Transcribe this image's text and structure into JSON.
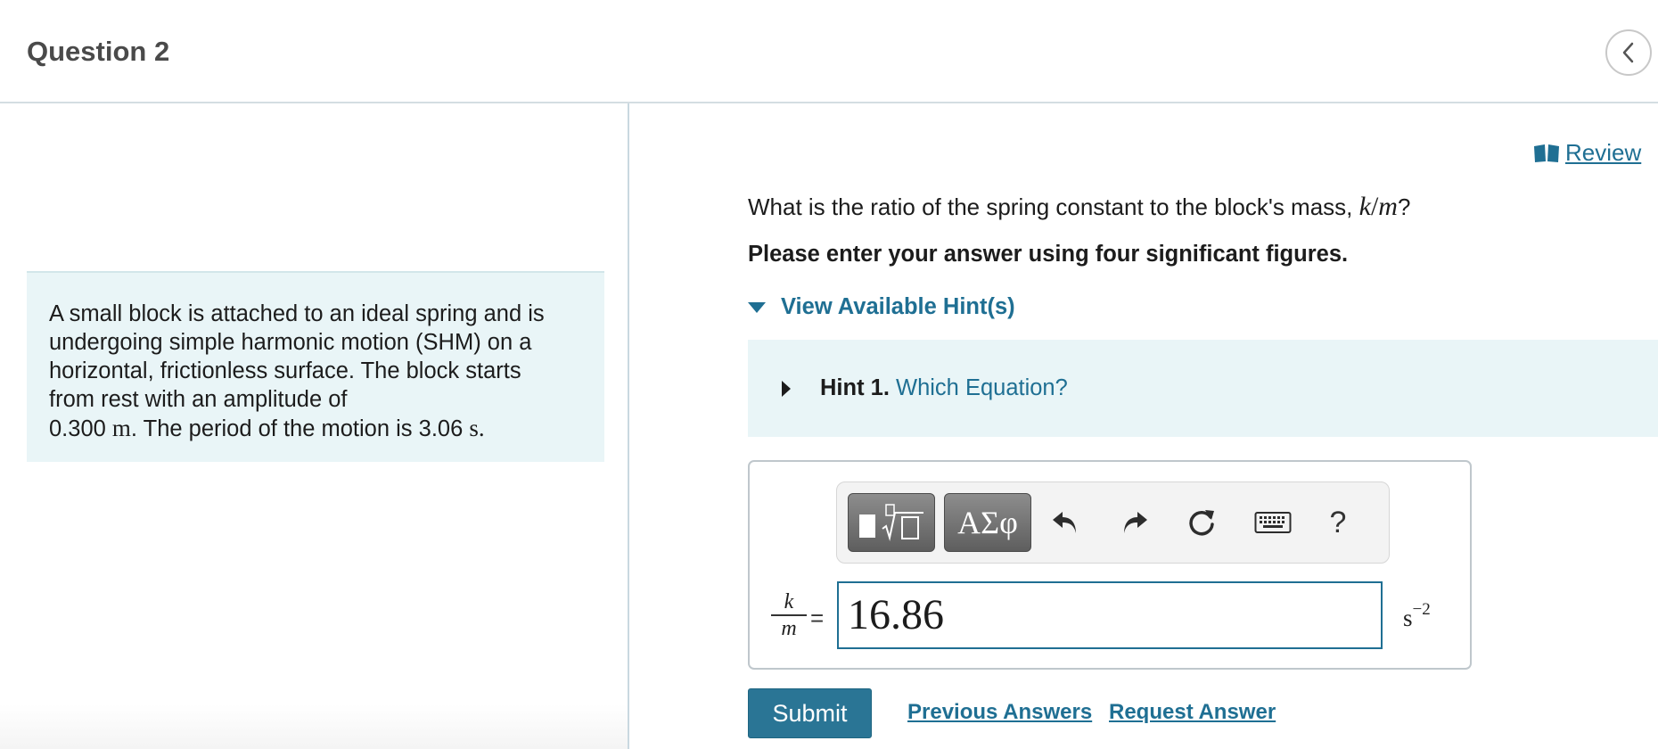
{
  "header": {
    "title": "Question 2",
    "back_icon": "chevron-left-icon"
  },
  "problem": {
    "text_lines": [
      "A small block is attached to an ideal spring and is",
      "undergoing simple harmonic motion (SHM) on a",
      "horizontal, frictionless surface. The block starts",
      "from rest with an amplitude of"
    ],
    "amplitude_value": "0.300",
    "amplitude_unit": "m",
    "period_text": ".  The period of the motion is 3.06",
    "period_unit": "s."
  },
  "review": {
    "label": " Review",
    "icon": "book-icon"
  },
  "question": {
    "text": "What is the ratio of the spring constant to the block's mass, ",
    "math_k": "k",
    "math_slash": "/",
    "math_m": "m",
    "end": "?",
    "instruction": "Please enter your answer using four significant figures."
  },
  "hints": {
    "toggle_label": "View Available Hint(s)",
    "items": [
      {
        "number": "Hint 1.",
        "title": "Which Equation?"
      }
    ]
  },
  "answer": {
    "toolbar": {
      "templates_icon": "templates-icon",
      "symbols_label": "ΑΣφ",
      "undo_icon": "undo-icon",
      "redo_icon": "redo-icon",
      "reset_icon": "reset-icon",
      "keyboard_icon": "keyboard-icon",
      "help_label": "?"
    },
    "var_numerator": "k",
    "var_denominator": "m",
    "equals": "=",
    "value": "16.86",
    "unit": "s",
    "unit_exponent": "−2"
  },
  "actions": {
    "submit": "Submit",
    "previous_answers": "Previous Answers",
    "request_answer": "Request Answer"
  },
  "colors": {
    "link": "#1f6f93",
    "panel_bg": "#e9f5f7",
    "submit_bg": "#2a7595"
  }
}
